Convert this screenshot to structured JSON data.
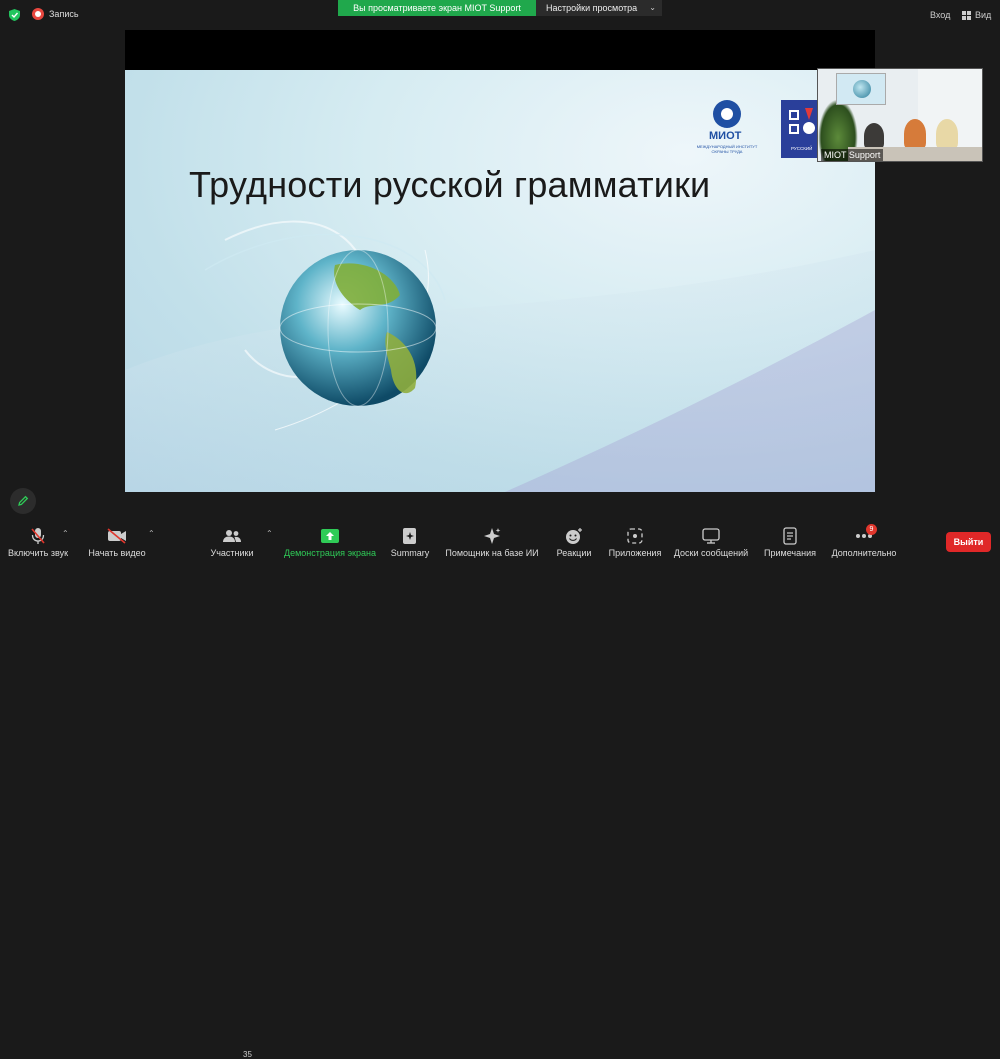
{
  "topbar": {
    "record_label": "Запись",
    "viewing_label": "Вы просматриваете экран MIOT Support",
    "view_options_label": "Настройки просмотра",
    "signin_label": "Вход",
    "view_label": "Вид"
  },
  "slide": {
    "title": "Трудности русской грамматики",
    "logo_name": "МИОТ",
    "logo_subtitle": "Международный институт охраны труда",
    "second_logo_label": "РУССКИЙ"
  },
  "thumbnail": {
    "participant_name": "MIOT Support"
  },
  "toolbar": {
    "audio_label": "Включить звук",
    "video_label": "Начать видео",
    "participants_label": "Участники",
    "participants_count": "35",
    "share_label": "Демонстрация экрана",
    "summary_label": "Summary",
    "ai_label": "Помощник на базе ИИ",
    "reactions_label": "Реакции",
    "apps_label": "Приложения",
    "whiteboards_label": "Доски сообщений",
    "notes_label": "Примечания",
    "more_label": "Дополнительно",
    "more_badge": "9",
    "exit_label": "Выйти"
  },
  "colors": {
    "share_green": "#2fcb57",
    "exit_red": "#e02828",
    "banner_green": "#20a84c"
  }
}
